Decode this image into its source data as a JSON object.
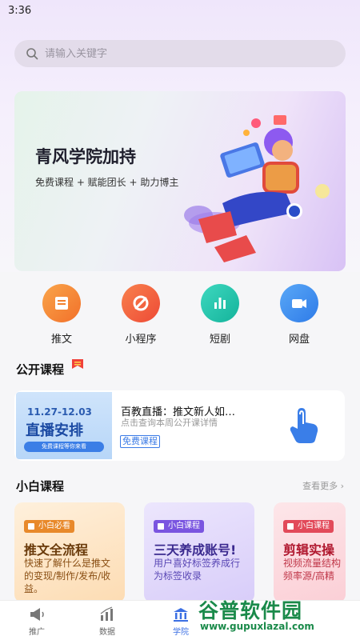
{
  "status_bar": {
    "time": "3:36"
  },
  "search": {
    "placeholder": "请输入关键字"
  },
  "banner": {
    "title": "青风学院加持",
    "subtitle": "免费课程 + 赋能团长 + 助力博主"
  },
  "quick_links": [
    {
      "label": "推文",
      "icon": "book-icon",
      "color": "#f5862d"
    },
    {
      "label": "小程序",
      "icon": "tools-icon",
      "color": "#f25c3c"
    },
    {
      "label": "短剧",
      "icon": "chart-bar-icon",
      "color": "#1fbfa7"
    },
    {
      "label": "网盘",
      "icon": "video-camera-icon",
      "color": "#3d8ef0"
    }
  ],
  "public_courses": {
    "title": "公开课程",
    "badge_icon": "hot-icon",
    "card": {
      "thumb_date": "11.27-12.03",
      "thumb_main": "直播安排",
      "thumb_pill": "免费课程等你来看",
      "title": "百教直播：推文新人如…",
      "description": "点击查询本周公开课详情",
      "tag": "免费课程"
    }
  },
  "beginner_courses": {
    "title": "小白课程",
    "see_more": "查看更多 ›",
    "cards": [
      {
        "tag": "小白必看",
        "title": "推文全流程",
        "desc": "快速了解什么是推文的变现/制作/发布/收益。",
        "tag_color": "#e8892b",
        "title_color": "#6a3a0a",
        "desc_color": "#8a4f14",
        "bg": "#fde9cf"
      },
      {
        "tag": "小白课程",
        "title": "三天养成账号!",
        "desc": "用户喜好标签养成行为标签收录",
        "tag_color": "#7a55e0",
        "title_color": "#3b2a8f",
        "desc_color": "#5a48b5",
        "bg": "#e3dcfb"
      },
      {
        "tag": "小白课程",
        "title": "剪辑实操",
        "desc": "视频流量结构频率源/高精",
        "tag_color": "#e24a5a",
        "title_color": "#b0172e",
        "desc_color": "#c0384a",
        "bg": "#fde0e4"
      }
    ]
  },
  "tabbar": {
    "items": [
      {
        "label": "推广",
        "icon": "megaphone-icon"
      },
      {
        "label": "数据",
        "icon": "chart-icon"
      },
      {
        "label": "学院",
        "icon": "academy-icon",
        "active": true
      }
    ]
  },
  "watermark": {
    "text": "谷普软件园",
    "url": "www.gupuxlazal.com"
  }
}
